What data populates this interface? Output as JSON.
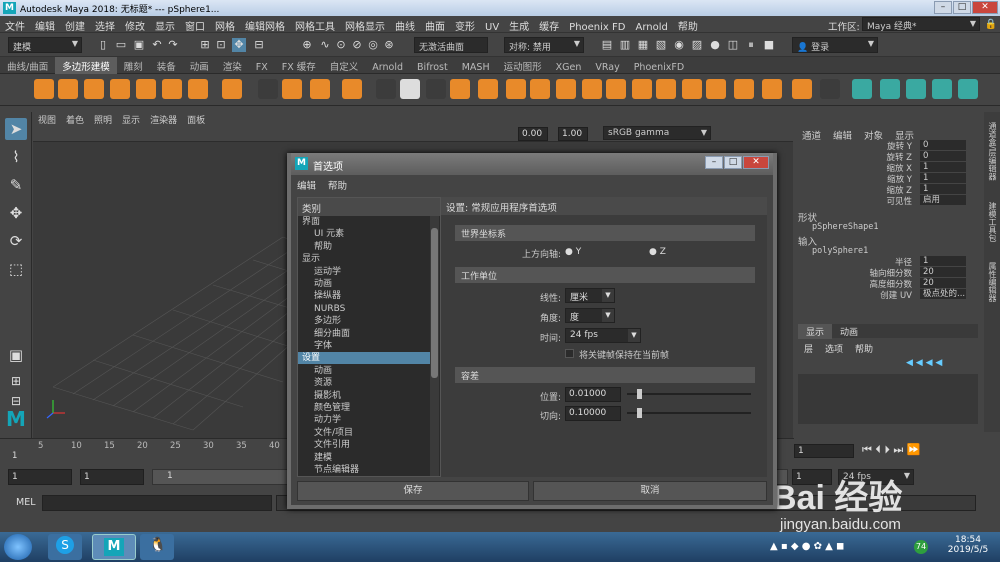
{
  "window": {
    "title": "Autodesk Maya 2018: 无标题*   ---   pSphere1...",
    "logo": "M"
  },
  "menubar": [
    "文件",
    "编辑",
    "创建",
    "选择",
    "修改",
    "显示",
    "窗口",
    "网格",
    "编辑网格",
    "网格工具",
    "网格显示",
    "曲线",
    "曲面",
    "变形",
    "UV",
    "生成",
    "缓存",
    "Phoenix FD",
    "Arnold",
    "帮助"
  ],
  "workspace": {
    "label": "工作区:",
    "value": "Maya 经典*"
  },
  "status": {
    "mode": "建模",
    "no_live_surface": "无激活曲面",
    "symmetry": "对称: 禁用",
    "login": "登录"
  },
  "shelf_tabs": [
    "曲线/曲面",
    "多边形建模",
    "雕刻",
    "装备",
    "动画",
    "渲染",
    "FX",
    "FX 缓存",
    "自定义",
    "Arnold",
    "Bifrost",
    "MASH",
    "运动图形",
    "XGen",
    "VRay",
    "PhoenixFD"
  ],
  "shelf_active": 1,
  "viewport": {
    "menus": [
      "视图",
      "着色",
      "照明",
      "显示",
      "渲染器",
      "面板"
    ],
    "exposure": "0.00",
    "gamma": "1.00",
    "color_space": "sRGB gamma"
  },
  "channel_box": {
    "menus": [
      "通道",
      "编辑",
      "对象",
      "显示"
    ],
    "rows": [
      {
        "k": "旋转 Y",
        "v": "0"
      },
      {
        "k": "旋转 Z",
        "v": "0"
      },
      {
        "k": "缩放 X",
        "v": "1"
      },
      {
        "k": "缩放 Y",
        "v": "1"
      },
      {
        "k": "缩放 Z",
        "v": "1"
      },
      {
        "k": "可见性",
        "v": "启用"
      }
    ],
    "shape_header": "形状",
    "shape_name": "pSphereShape1",
    "input_header": "输入",
    "input_name": "polySphere1",
    "input_rows": [
      {
        "k": "半径",
        "v": "1"
      },
      {
        "k": "轴向细分数",
        "v": "20"
      },
      {
        "k": "高度细分数",
        "v": "20"
      },
      {
        "k": "创建 UV",
        "v": "极点处的..."
      }
    ]
  },
  "layer_editor": {
    "tabs": [
      "显示",
      "动画"
    ],
    "menus": [
      "层",
      "选项",
      "帮助"
    ]
  },
  "side_tabs": [
    "通道盒/层编辑器",
    "建模工具包",
    "属性编辑器"
  ],
  "timeline": {
    "ticks": [
      "5",
      "10",
      "15",
      "20",
      "25",
      "30",
      "35",
      "40"
    ],
    "start": "1",
    "frame": "1",
    "range_start": "1",
    "range_end": "1",
    "current": "1",
    "fps": "24 fps"
  },
  "cmdline": {
    "label": "MEL"
  },
  "taskbar": {
    "time": "18:54",
    "date": "2019/5/5",
    "badge": "74"
  },
  "watermark": "Bai 经验",
  "watermark_url": "jingyan.baidu.com",
  "dialog": {
    "title": "首选项",
    "menus": [
      "编辑",
      "帮助"
    ],
    "category_header": "类别",
    "categories": [
      {
        "label": "界面",
        "sub": false
      },
      {
        "label": "UI 元素",
        "sub": true
      },
      {
        "label": "帮助",
        "sub": true
      },
      {
        "label": "显示",
        "sub": false
      },
      {
        "label": "运动学",
        "sub": true
      },
      {
        "label": "动画",
        "sub": true
      },
      {
        "label": "操纵器",
        "sub": true
      },
      {
        "label": "NURBS",
        "sub": true
      },
      {
        "label": "多边形",
        "sub": true
      },
      {
        "label": "细分曲面",
        "sub": true
      },
      {
        "label": "字体",
        "sub": true
      },
      {
        "label": "设置",
        "sub": false,
        "selected": true
      },
      {
        "label": "动画",
        "sub": true
      },
      {
        "label": "资源",
        "sub": true
      },
      {
        "label": "摄影机",
        "sub": true
      },
      {
        "label": "颜色管理",
        "sub": true
      },
      {
        "label": "动力学",
        "sub": true
      },
      {
        "label": "文件/项目",
        "sub": true
      },
      {
        "label": "文件引用",
        "sub": true
      },
      {
        "label": "建模",
        "sub": true
      },
      {
        "label": "节点编辑器",
        "sub": true
      }
    ],
    "settings_header": "设置: 常规应用程序首选项",
    "world": {
      "header": "世界坐标系",
      "up_axis_label": "上方向轴:",
      "y": "Y",
      "z": "Z"
    },
    "units": {
      "header": "工作单位",
      "linear_label": "线性:",
      "linear": "厘米",
      "angle_label": "角度:",
      "angle": "度",
      "time_label": "时间:",
      "time": "24 fps",
      "keep_keys": "将关键帧保持在当前帧"
    },
    "tolerance": {
      "header": "容差",
      "position_label": "位置:",
      "position": "0.01000",
      "tangent_label": "切向:",
      "tangent": "0.10000"
    },
    "save": "保存",
    "cancel": "取消"
  }
}
